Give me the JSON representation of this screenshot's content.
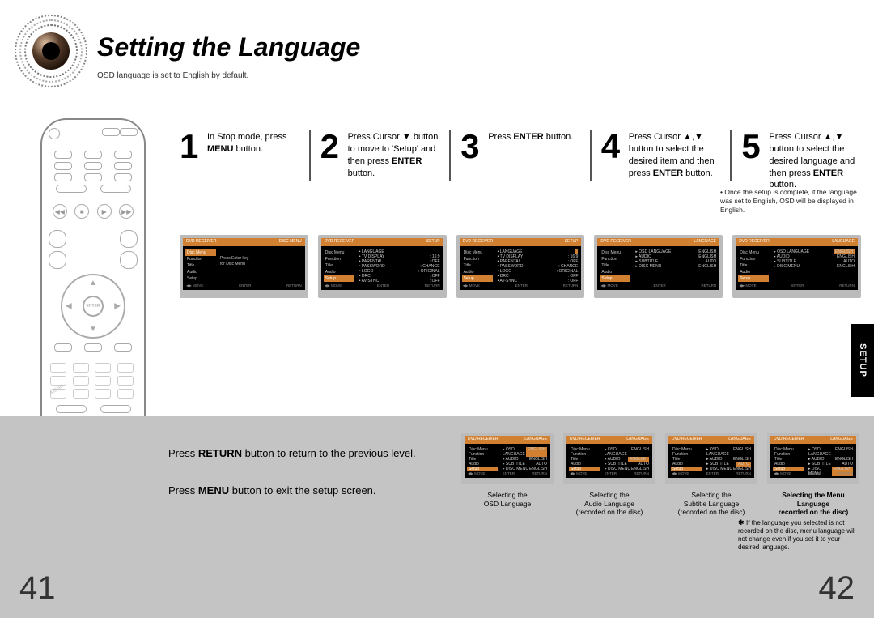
{
  "title": "Setting the Language",
  "subtitle": "OSD language is set to English by default.",
  "steps": [
    {
      "num": "1",
      "html": "In Stop mode, press <b>MENU</b> button."
    },
    {
      "num": "2",
      "html": "Press Cursor ▼ button to move to 'Setup' and then press <b>ENTER</b> button."
    },
    {
      "num": "3",
      "html": "Press <b>ENTER</b> button."
    },
    {
      "num": "4",
      "html": "Press Cursor ▲,▼ button to select the desired item and then press <b>ENTER</b> button."
    },
    {
      "num": "5",
      "html": "Press Cursor ▲,▼ button to select the desired language and then press <b>ENTER</b> button."
    }
  ],
  "top_note": "Once the setup is complete, if the language was set to English, OSD will be displayed in English.",
  "return_note_html": "Press <b>RETURN</b> button to return to the previous level.",
  "menu_note_html": "Press <b>MENU</b> button to exit the setup screen.",
  "side_tab": "SETUP",
  "page_left": "41",
  "page_right": "42",
  "screen_menu": {
    "sidebar": [
      "Disc Menu",
      "Function",
      "Title",
      "Audio",
      "Setup"
    ],
    "setup_rows": [
      {
        "k": "LANGUAGE",
        "v": ""
      },
      {
        "k": "TV DISPLAY",
        "v": ": 16:9"
      },
      {
        "k": "PARENTAL",
        "v": ": OFF"
      },
      {
        "k": "PASSWORD",
        "v": ": CHANGE"
      },
      {
        "k": "LOGO",
        "v": ": ORIGINAL"
      },
      {
        "k": "DRC",
        "v": ": OFF"
      },
      {
        "k": "AV-SYNC",
        "v": ": OFF"
      }
    ],
    "lang_rows": [
      {
        "k": "OSD LANGUAGE",
        "v": "ENGLISH"
      },
      {
        "k": "AUDIO",
        "v": "ENGLISH"
      },
      {
        "k": "SUBTITLE",
        "v": "AUTO"
      },
      {
        "k": "DISC MENU",
        "v": "ENGLISH"
      }
    ],
    "enter_msg": [
      "Press Enter key",
      "for Disc Menu"
    ],
    "footer": [
      "◀▶ MOVE",
      "ENTER",
      "RETURN"
    ]
  },
  "captions": [
    {
      "lines": [
        "Selecting the",
        "OSD Language"
      ],
      "bold": false
    },
    {
      "lines": [
        "Selecting the",
        "Audio Language",
        "(recorded on the disc)"
      ],
      "bold": false
    },
    {
      "lines": [
        "Selecting the",
        "Subtitle Language",
        "(recorded on the disc)"
      ],
      "bold": false
    },
    {
      "lines": [
        "Selecting the Menu Language",
        "recorded on the disc)"
      ],
      "bold": true
    }
  ],
  "star_note": "If the language you selected is not recorded on the disc, menu language will not change even if you set it to your desired language.",
  "remote_enter": "ENTER"
}
